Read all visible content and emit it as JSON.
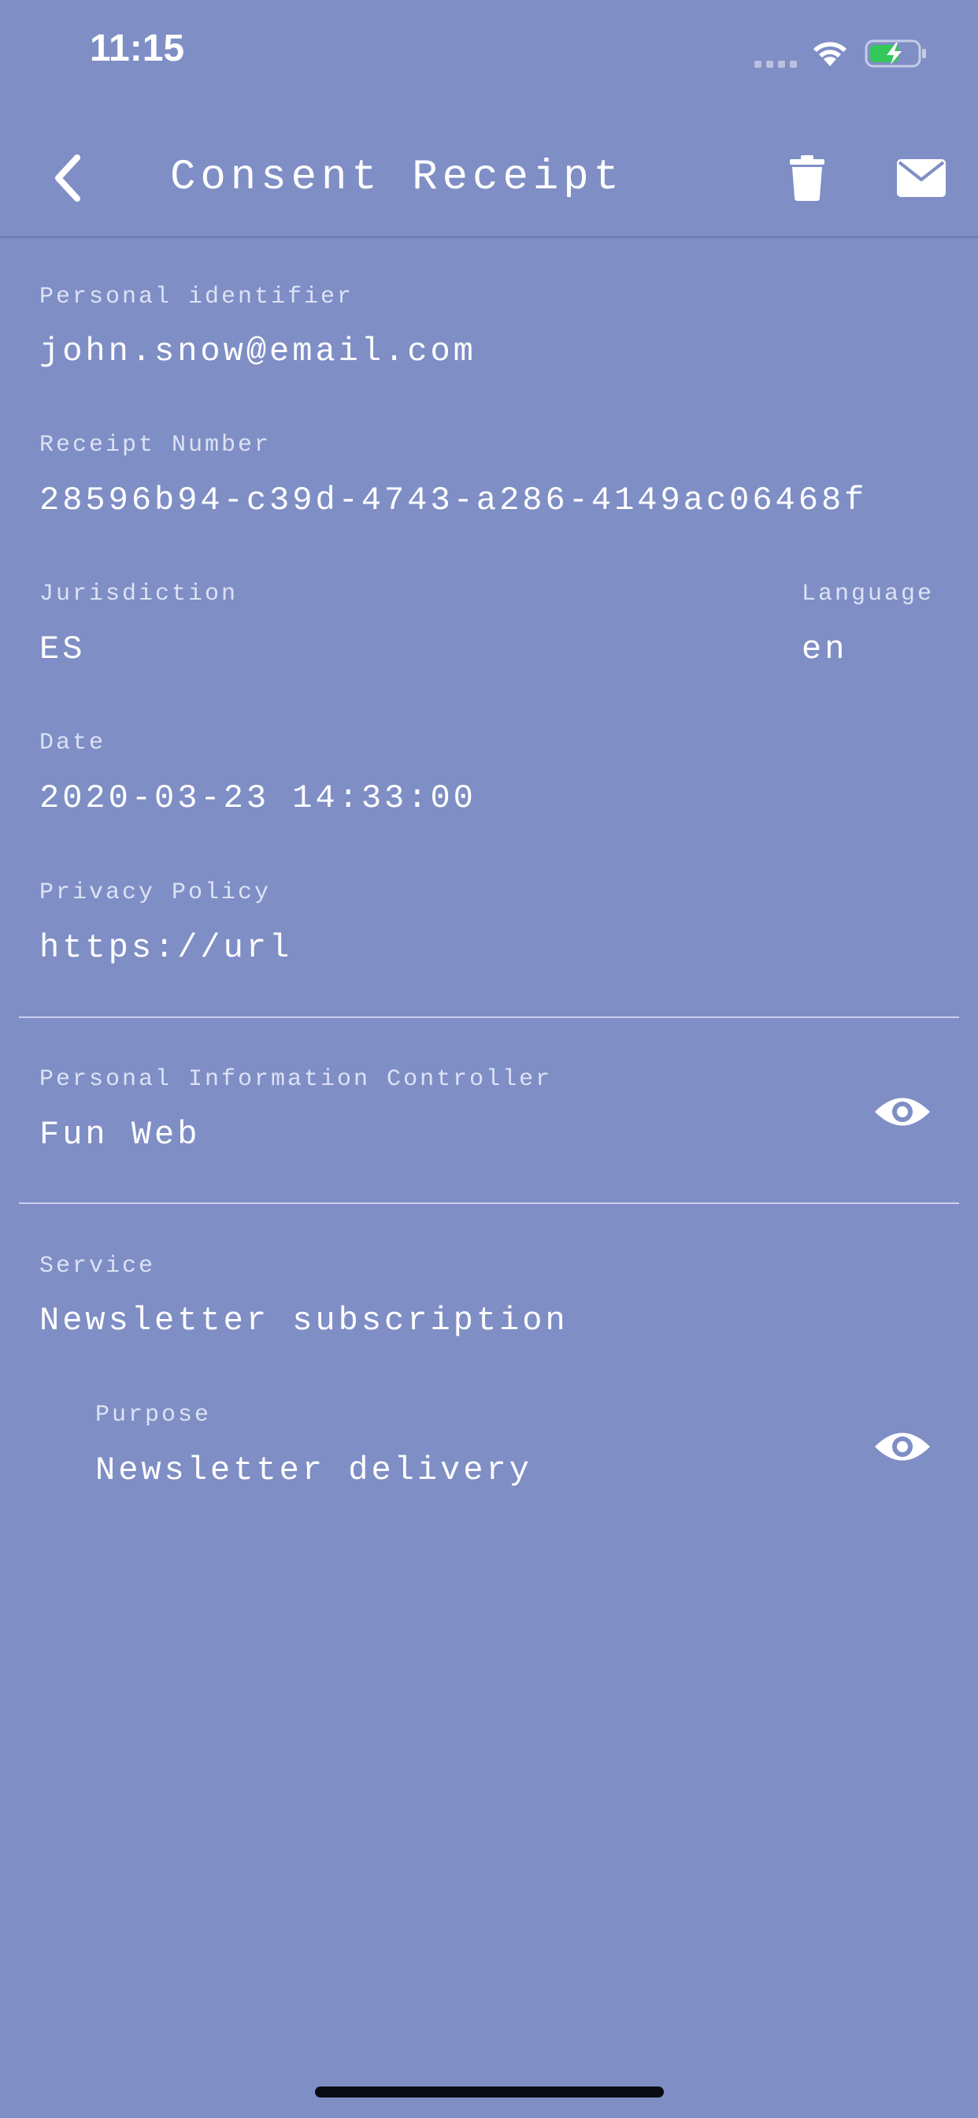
{
  "status_bar": {
    "time": "11:15"
  },
  "nav": {
    "title": "Consent Receipt",
    "back_icon": "chevron-left-icon",
    "trash_icon": "trash-icon",
    "mail_icon": "mail-icon"
  },
  "fields": {
    "personal_identifier": {
      "label": "Personal identifier",
      "value": "john.snow@email.com"
    },
    "receipt_number": {
      "label": "Receipt Number",
      "value": "28596b94-c39d-4743-a286-4149ac06468f"
    },
    "jurisdiction": {
      "label": "Jurisdiction",
      "value": "ES"
    },
    "language": {
      "label": "Language",
      "value": "en"
    },
    "date": {
      "label": "Date",
      "value": "2020-03-23 14:33:00"
    },
    "privacy_policy": {
      "label": "Privacy Policy",
      "value": "https://url"
    }
  },
  "controller": {
    "label": "Personal Information Controller",
    "value": "Fun Web",
    "view_icon": "eye-icon"
  },
  "service": {
    "label": "Service",
    "value": "Newsletter subscription",
    "purpose": {
      "label": "Purpose",
      "value": "Newsletter delivery",
      "view_icon": "eye-icon"
    }
  },
  "colors": {
    "background": "#7f8ec5",
    "text": "#ffffff",
    "battery_fill": "#34c759"
  }
}
